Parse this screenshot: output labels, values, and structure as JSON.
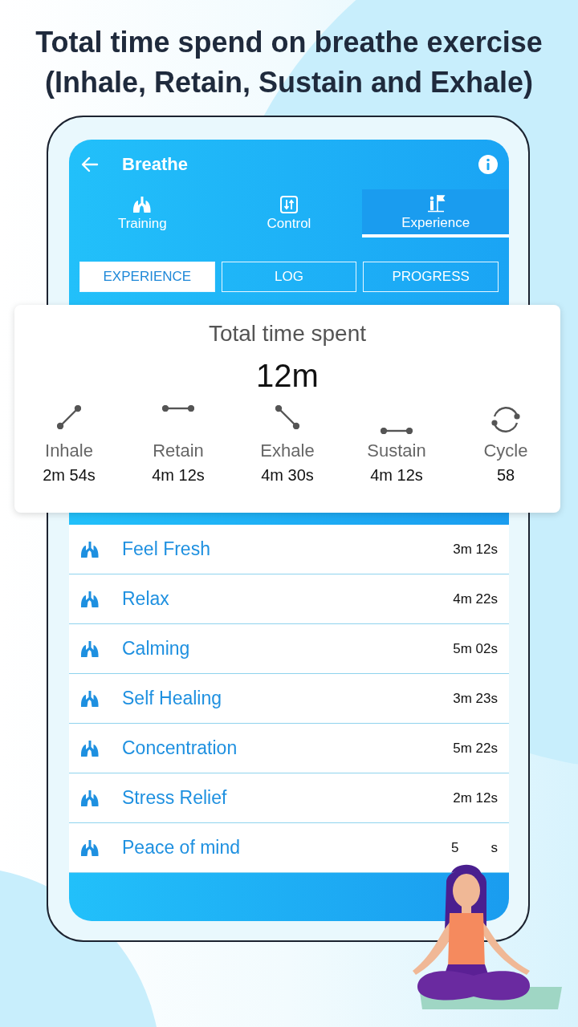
{
  "headline": "Total time spend on breathe exercise (Inhale, Retain, Sustain and Exhale)",
  "app_bar": {
    "title": "Breathe"
  },
  "tabs": [
    {
      "label": "Training",
      "kind": "lungs",
      "selected": false
    },
    {
      "label": "Control",
      "kind": "sliders",
      "selected": false
    },
    {
      "label": "Experience",
      "kind": "flag",
      "selected": true
    }
  ],
  "subtabs": [
    {
      "label": "EXPERIENCE",
      "selected": true
    },
    {
      "label": "LOG",
      "selected": false
    },
    {
      "label": "PROGRESS",
      "selected": false
    }
  ],
  "summary": {
    "title": "Total time spent",
    "total": "12m",
    "stats": [
      {
        "kind": "inhale",
        "label": "Inhale",
        "value": "2m 54s"
      },
      {
        "kind": "retain",
        "label": "Retain",
        "value": "4m 12s"
      },
      {
        "kind": "exhale",
        "label": "Exhale",
        "value": "4m 30s"
      },
      {
        "kind": "sustain",
        "label": "Sustain",
        "value": "4m 12s"
      },
      {
        "kind": "cycle",
        "label": "Cycle",
        "value": "58"
      }
    ]
  },
  "exercises": [
    {
      "name": "Feel Fresh",
      "time": "3m 12s"
    },
    {
      "name": "Relax",
      "time": "4m 22s"
    },
    {
      "name": "Calming",
      "time": "5m 02s"
    },
    {
      "name": "Self Healing",
      "time": "3m 23s"
    },
    {
      "name": "Concentration",
      "time": "5m 22s"
    },
    {
      "name": "Stress Relief",
      "time": "2m 12s"
    },
    {
      "name": "Peace of mind",
      "time_fragments": [
        "5",
        "s"
      ]
    }
  ]
}
